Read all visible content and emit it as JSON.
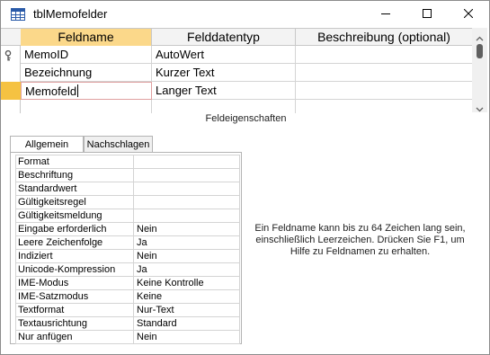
{
  "window": {
    "title": "tblMemofelder",
    "icons": {
      "app": "table-icon",
      "minimize": "minimize-icon",
      "maximize": "maximize-icon",
      "close": "close-icon"
    }
  },
  "grid": {
    "columns": [
      "Feldname",
      "Felddatentyp",
      "Beschreibung (optional)"
    ],
    "rows": [
      {
        "name": "MemoID",
        "type": "AutoWert",
        "description": "",
        "primary_key": true
      },
      {
        "name": "Bezeichnung",
        "type": "Kurzer Text",
        "description": ""
      },
      {
        "name": "Memofeld",
        "type": "Langer Text",
        "description": "",
        "current": true
      }
    ]
  },
  "properties": {
    "title": "Feldeigenschaften",
    "tabs": [
      "Allgemein",
      "Nachschlagen"
    ],
    "active_tab": "Allgemein",
    "rows": [
      {
        "label": "Format",
        "value": ""
      },
      {
        "label": "Beschriftung",
        "value": ""
      },
      {
        "label": "Standardwert",
        "value": ""
      },
      {
        "label": "Gültigkeitsregel",
        "value": ""
      },
      {
        "label": "Gültigkeitsmeldung",
        "value": ""
      },
      {
        "label": "Eingabe erforderlich",
        "value": "Nein"
      },
      {
        "label": "Leere Zeichenfolge",
        "value": "Ja"
      },
      {
        "label": "Indiziert",
        "value": "Nein"
      },
      {
        "label": "Unicode-Kompression",
        "value": "Ja"
      },
      {
        "label": "IME-Modus",
        "value": "Keine Kontrolle"
      },
      {
        "label": "IME-Satzmodus",
        "value": "Keine"
      },
      {
        "label": "Textformat",
        "value": "Nur-Text"
      },
      {
        "label": "Textausrichtung",
        "value": "Standard"
      },
      {
        "label": "Nur anfügen",
        "value": "Nein"
      }
    ],
    "help": "Ein Feldname kann bis zu 64 Zeichen lang sein, einschließlich Leerzeichen. Drücken Sie F1, um Hilfe zu Feldnamen zu erhalten."
  },
  "colors": {
    "selected_header": "#fbd88a",
    "current_row_selector": "#f5c242",
    "primary_key": "#d8a000"
  }
}
